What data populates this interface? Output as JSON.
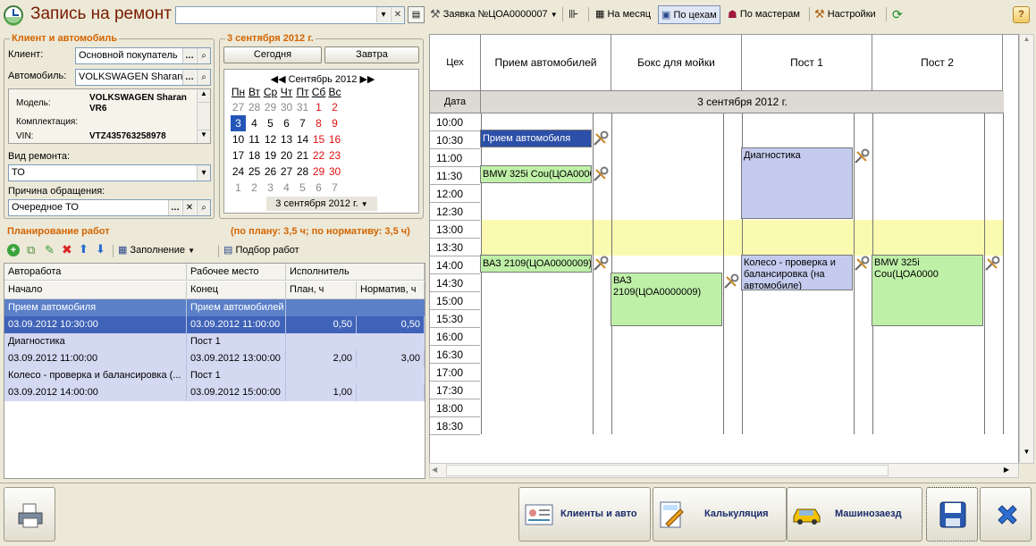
{
  "window": {
    "title": "Запись на ремонт",
    "title_input": ""
  },
  "toolbar": {
    "request_label": "Заявка №ЦОА0000007",
    "month_label": "На месяц",
    "by_shop_label": "По цехам",
    "by_master_label": "По мастерам",
    "settings_label": "Настройки",
    "help_label": "?"
  },
  "client_group": {
    "title": "Клиент и автомобиль",
    "client_label": "Клиент:",
    "client_value": "Основной покупатель",
    "car_label": "Автомобиль:",
    "car_value": "VOLKSWAGEN Sharan",
    "model_label": "Модель:",
    "model_value": "VOLKSWAGEN Sharan VR6",
    "config_label": "Комплектация:",
    "config_value": "",
    "vin_label": "VIN:",
    "vin_value": "VTZ435763258978",
    "repair_type_label": "Вид ремонта:",
    "repair_type_value": "ТО",
    "reason_label": "Причина обращения:",
    "reason_value": "Очередное ТО"
  },
  "date_group": {
    "title": "3 сентября 2012 г.",
    "today_label": "Сегодня",
    "tomorrow_label": "Завтра",
    "month_header": "Сентябрь 2012",
    "weekdays": [
      "Пн",
      "Вт",
      "Ср",
      "Чт",
      "Пт",
      "Сб",
      "Вс"
    ],
    "weeks": [
      [
        "27",
        "28",
        "29",
        "30",
        "31",
        "1",
        "2"
      ],
      [
        "3",
        "4",
        "5",
        "6",
        "7",
        "8",
        "9"
      ],
      [
        "10",
        "11",
        "12",
        "13",
        "14",
        "15",
        "16"
      ],
      [
        "17",
        "18",
        "19",
        "20",
        "21",
        "22",
        "23"
      ],
      [
        "24",
        "25",
        "26",
        "27",
        "28",
        "29",
        "30"
      ],
      [
        "1",
        "2",
        "3",
        "4",
        "5",
        "6",
        "7"
      ]
    ],
    "selected_value": "3 сентября 2012 г."
  },
  "planning": {
    "title": "Планирование работ",
    "summary": "(по плану: 3,5 ч; по нормативу: 3,5 ч)",
    "fill_label": "Заполнение",
    "pick_label": "Подбор работ",
    "headers1": [
      "Авторабота",
      "Рабочее место",
      "Исполнитель"
    ],
    "headers2": [
      "Начало",
      "Конец",
      "План, ч",
      "Норматив, ч"
    ],
    "rows": [
      {
        "work": "Прием автомобиля",
        "place": "Прием автомобилей",
        "start": "03.09.2012 10:30:00",
        "end": "03.09.2012 11:00:00",
        "plan": "0,50",
        "norm": "0,50"
      },
      {
        "work": "Диагностика",
        "place": "Пост 1",
        "start": "03.09.2012 11:00:00",
        "end": "03.09.2012 13:00:00",
        "plan": "2,00",
        "norm": "3,00"
      },
      {
        "work": "Колесо - проверка и балансировка (...",
        "place": "Пост 1",
        "start": "03.09.2012 14:00:00",
        "end": "03.09.2012 15:00:00",
        "plan": "1,00",
        "norm": ""
      }
    ]
  },
  "schedule": {
    "shop_header": "Цех",
    "date_header": "Дата",
    "columns": [
      "Прием автомобилей",
      "Бокс для мойки",
      "Пост 1",
      "Пост 2"
    ],
    "date_value": "3 сентября 2012 г.",
    "times": [
      "10:00",
      "10:30",
      "11:00",
      "11:30",
      "12:00",
      "12:30",
      "13:00",
      "13:30",
      "14:00",
      "14:30",
      "15:00",
      "15:30",
      "16:00",
      "16:30",
      "17:00",
      "17:30",
      "18:00",
      "18:30"
    ],
    "events": [
      "Прием автомобиля",
      "BMW 325i Cou(ЦОА0000",
      "ВАЗ 2109(ЦОА0000009)",
      "ВАЗ 2109(ЦОА0000009)",
      "Диагностика",
      "Колесо - проверка и балансировка (на автомобиле)",
      "BMW 325i Cou(ЦОА0000"
    ]
  },
  "bottom": {
    "clients_label": "Клиенты и авто",
    "calc_label": "Калькуляция",
    "arrival_label": "Машинозаезд"
  },
  "colors": {
    "accent_orange": "#d46400",
    "selected_blue": "#3f63b8",
    "event_blue": "#2c4fa8",
    "event_green": "#bff0a8",
    "event_lavender": "#c5cbee",
    "lunch_yellow": "#fafab0"
  }
}
